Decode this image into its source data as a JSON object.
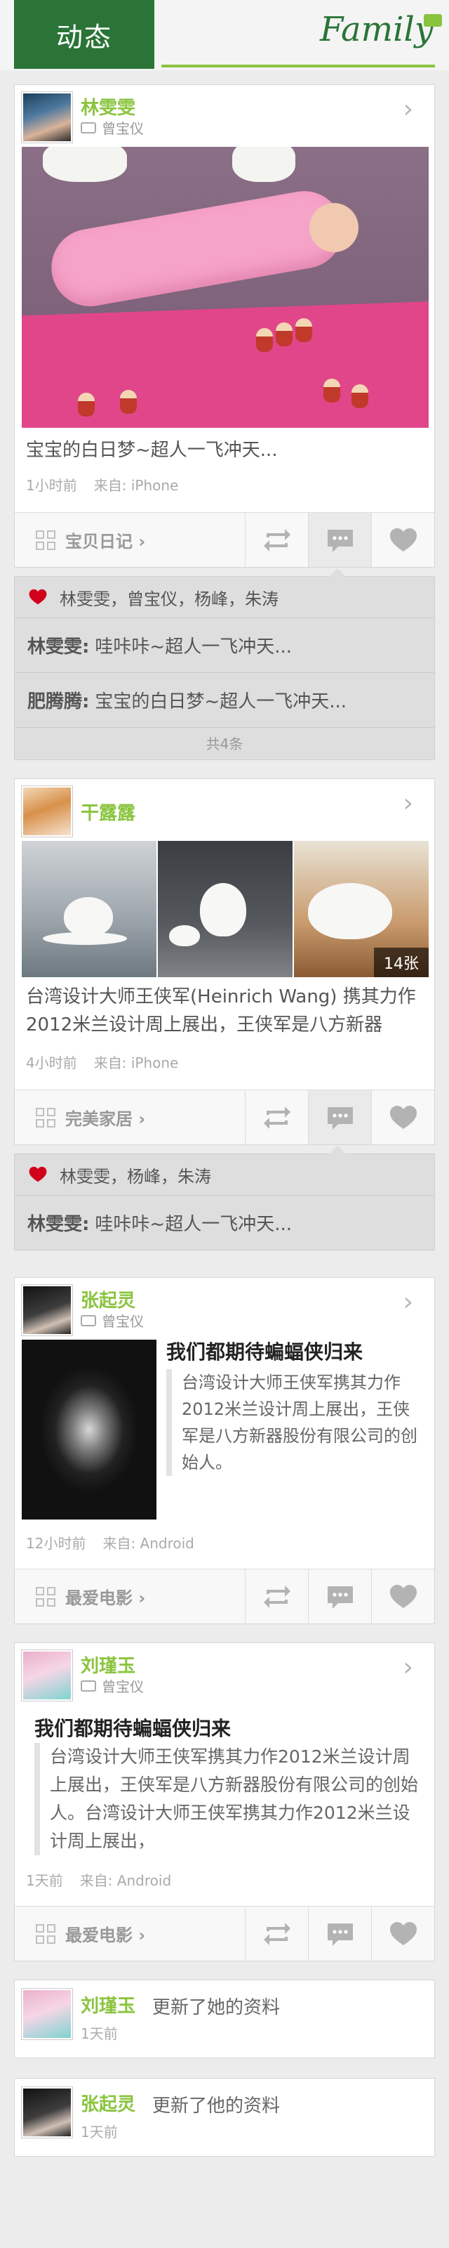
{
  "header": {
    "tab_label": "动态",
    "brand": "Family"
  },
  "posts": [
    {
      "user": "林雯雯",
      "repost_from": "曾宝仪",
      "caption": "宝宝的白日梦~超人一飞冲天...",
      "time": "1小时前",
      "source": "来自: iPhone",
      "category": "宝贝日记 ›"
    },
    {
      "user": "干露露",
      "caption": "台湾设计大师王侠军(Heinrich  Wang) 携其力作2012米兰设计周上展出，王侠军是八方新器",
      "image_count": "14张",
      "time": "4小时前",
      "source": "来自: iPhone",
      "category": "完美家居 ›"
    },
    {
      "user": "张起灵",
      "repost_from": "曾宝仪",
      "article_title": "我们都期待蝙蝠侠归来",
      "article_text": "台湾设计大师王侠军携其力作2012米兰设计周上展出，王侠军是八方新器股份有限公司的创始人。",
      "time": "12小时前",
      "source": "来自: Android",
      "category": "最爱电影 ›"
    },
    {
      "user": "刘瑾玉",
      "repost_from": "曾宝仪",
      "article_title": "我们都期待蝙蝠侠归来",
      "article_text": "台湾设计大师王侠军携其力作2012米兰设计周上展出，王侠军是八方新器股份有限公司的创始人。台湾设计大师王侠军携其力作2012米兰设计周上展出，",
      "time": "1天前",
      "source": "来自: Android",
      "category": "最爱电影 ›"
    }
  ],
  "interactions": [
    {
      "likes": "林雯雯，曾宝仪，杨峰，朱涛",
      "comments": [
        {
          "author": "林雯雯:",
          "text": "哇咔咔~超人一飞冲天..."
        },
        {
          "author": "肥腾腾:",
          "text": "宝宝的白日梦~超人一飞冲天..."
        }
      ],
      "total": "共4条"
    },
    {
      "likes": "林雯雯，杨峰，朱涛",
      "comments": [
        {
          "author": "林雯雯:",
          "text": "哇咔咔~超人一飞冲天..."
        }
      ]
    }
  ],
  "updates": [
    {
      "user": "刘瑾玉",
      "text": "更新了她的资料",
      "time": "1天前"
    },
    {
      "user": "张起灵",
      "text": "更新了他的资料",
      "time": "1天前"
    }
  ],
  "colors": {
    "brand_green": "#2a7437",
    "accent_green": "#8ac43f",
    "like_red": "#d0021b"
  },
  "icons": [
    "repost-icon",
    "comment-icon",
    "heart-icon",
    "grid-icon",
    "chevron-right-icon"
  ]
}
